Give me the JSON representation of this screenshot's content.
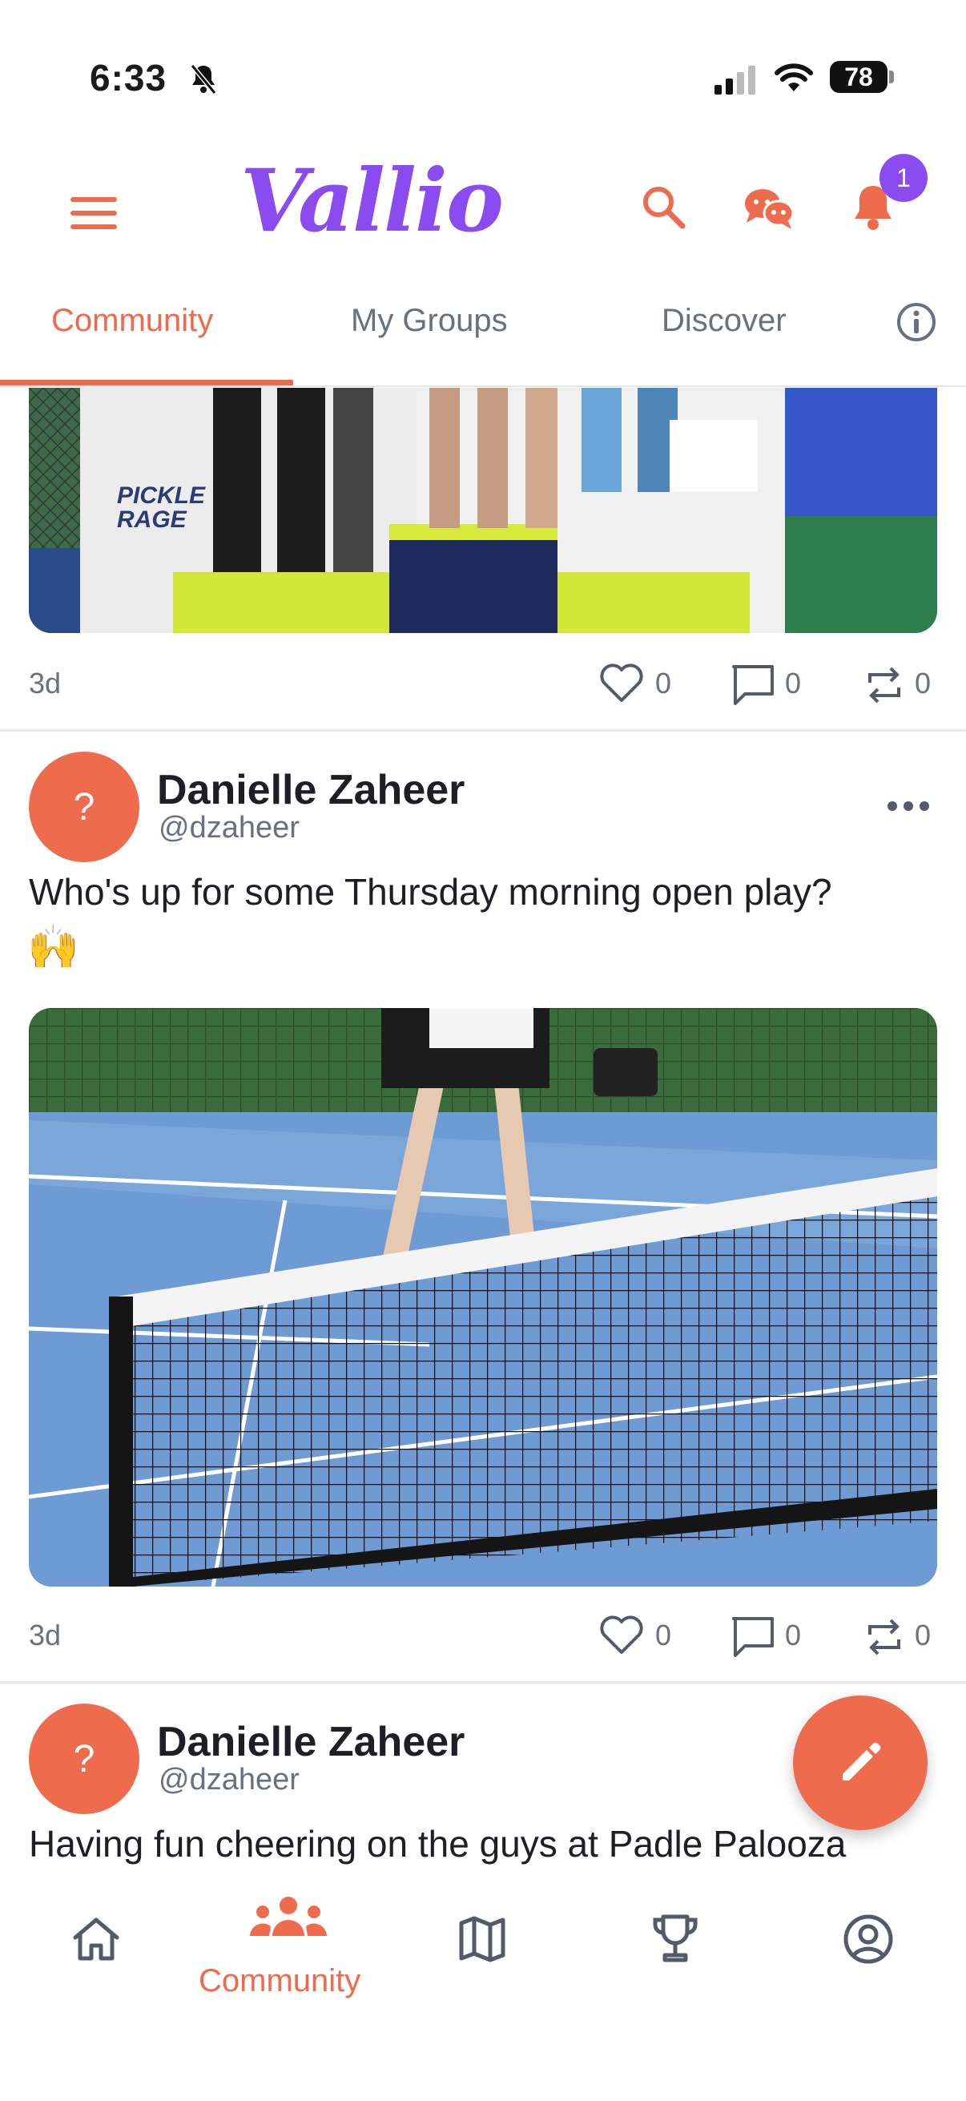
{
  "status_bar": {
    "time": "6:33",
    "battery": "78"
  },
  "header": {
    "logo": "Vallio",
    "notification_count": "1"
  },
  "tabs": [
    {
      "label": "Community",
      "active": true
    },
    {
      "label": "My Groups",
      "active": false
    },
    {
      "label": "Discover",
      "active": false
    }
  ],
  "posts": [
    {
      "time_ago": "3d",
      "likes": "0",
      "comments": "0",
      "reposts": "0"
    },
    {
      "avatar": "?",
      "author": "Danielle Zaheer",
      "handle": "@dzaheer",
      "text": "Who's up for some Thursday morning open play?",
      "emoji": "🙌",
      "time_ago": "3d",
      "likes": "0",
      "comments": "0",
      "reposts": "0"
    },
    {
      "avatar": "?",
      "author": "Danielle Zaheer",
      "handle": "@dzaheer",
      "text": "Having fun cheering on the guys at Padle Palooza"
    }
  ],
  "podium_banner": "PICKLE RAGE",
  "bottom_nav": {
    "active_label": "Community"
  },
  "colors": {
    "brand": "#8a4cf0",
    "accent": "#ee6c4d",
    "muted": "#6b6f82"
  }
}
